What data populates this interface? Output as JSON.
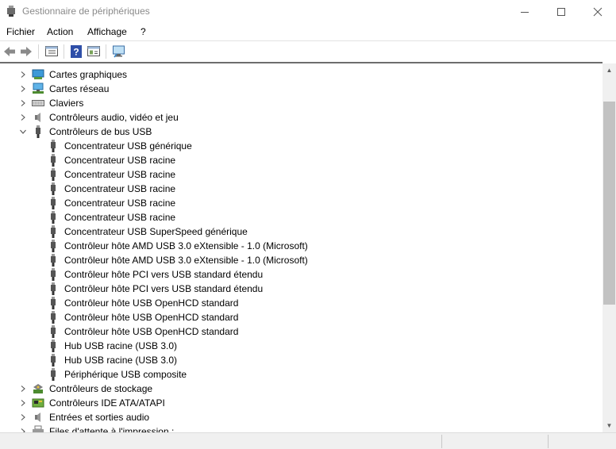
{
  "window": {
    "title": "Gestionnaire de périphériques"
  },
  "menu": {
    "items": [
      "Fichier",
      "Action",
      "Affichage",
      "?"
    ]
  },
  "toolbar": {
    "buttons": [
      "back-arrow-icon",
      "forward-arrow-icon",
      "properties-pane-icon",
      "help-icon",
      "details-pane-icon",
      "monitor-scan-icon"
    ]
  },
  "tree": {
    "items": [
      {
        "label": "Cartes graphiques",
        "expanded": false,
        "icon": "display-adapter-icon"
      },
      {
        "label": "Cartes réseau",
        "expanded": false,
        "icon": "network-adapter-icon"
      },
      {
        "label": "Claviers",
        "expanded": false,
        "icon": "keyboard-icon"
      },
      {
        "label": "Contrôleurs audio, vidéo et jeu",
        "expanded": false,
        "icon": "speaker-icon"
      },
      {
        "label": "Contrôleurs de bus USB",
        "expanded": true,
        "icon": "usb-icon"
      },
      {
        "label": "Concentrateur USB générique",
        "child": true,
        "icon": "usb-icon"
      },
      {
        "label": "Concentrateur USB racine",
        "child": true,
        "icon": "usb-icon"
      },
      {
        "label": "Concentrateur USB racine",
        "child": true,
        "icon": "usb-icon"
      },
      {
        "label": "Concentrateur USB racine",
        "child": true,
        "icon": "usb-icon"
      },
      {
        "label": "Concentrateur USB racine",
        "child": true,
        "icon": "usb-icon"
      },
      {
        "label": "Concentrateur USB racine",
        "child": true,
        "icon": "usb-icon"
      },
      {
        "label": "Concentrateur USB SuperSpeed générique",
        "child": true,
        "icon": "usb-icon"
      },
      {
        "label": "Contrôleur hôte AMD USB 3.0 eXtensible - 1.0 (Microsoft)",
        "child": true,
        "icon": "usb-icon"
      },
      {
        "label": "Contrôleur hôte AMD USB 3.0 eXtensible - 1.0 (Microsoft)",
        "child": true,
        "icon": "usb-icon"
      },
      {
        "label": "Contrôleur hôte PCI vers USB standard étendu",
        "child": true,
        "icon": "usb-icon"
      },
      {
        "label": "Contrôleur hôte PCI vers USB standard étendu",
        "child": true,
        "icon": "usb-icon"
      },
      {
        "label": "Contrôleur hôte USB OpenHCD standard",
        "child": true,
        "icon": "usb-icon"
      },
      {
        "label": "Contrôleur hôte USB OpenHCD standard",
        "child": true,
        "icon": "usb-icon"
      },
      {
        "label": "Contrôleur hôte USB OpenHCD standard",
        "child": true,
        "icon": "usb-icon"
      },
      {
        "label": "Hub USB racine (USB 3.0)",
        "child": true,
        "icon": "usb-icon"
      },
      {
        "label": "Hub USB racine (USB 3.0)",
        "child": true,
        "icon": "usb-icon"
      },
      {
        "label": "Périphérique USB composite",
        "child": true,
        "icon": "usb-icon"
      },
      {
        "label": "Contrôleurs de stockage",
        "expanded": false,
        "icon": "storage-controller-icon"
      },
      {
        "label": "Contrôleurs IDE ATA/ATAPI",
        "expanded": false,
        "icon": "ide-controller-icon"
      },
      {
        "label": "Entrées et sorties audio",
        "expanded": false,
        "icon": "speaker-icon"
      },
      {
        "label": "Files d'attente à l'impression :",
        "expanded": false,
        "icon": "printer-icon"
      }
    ]
  },
  "scrollbar": {
    "position": 0.14,
    "visible_fraction": 0.55
  }
}
